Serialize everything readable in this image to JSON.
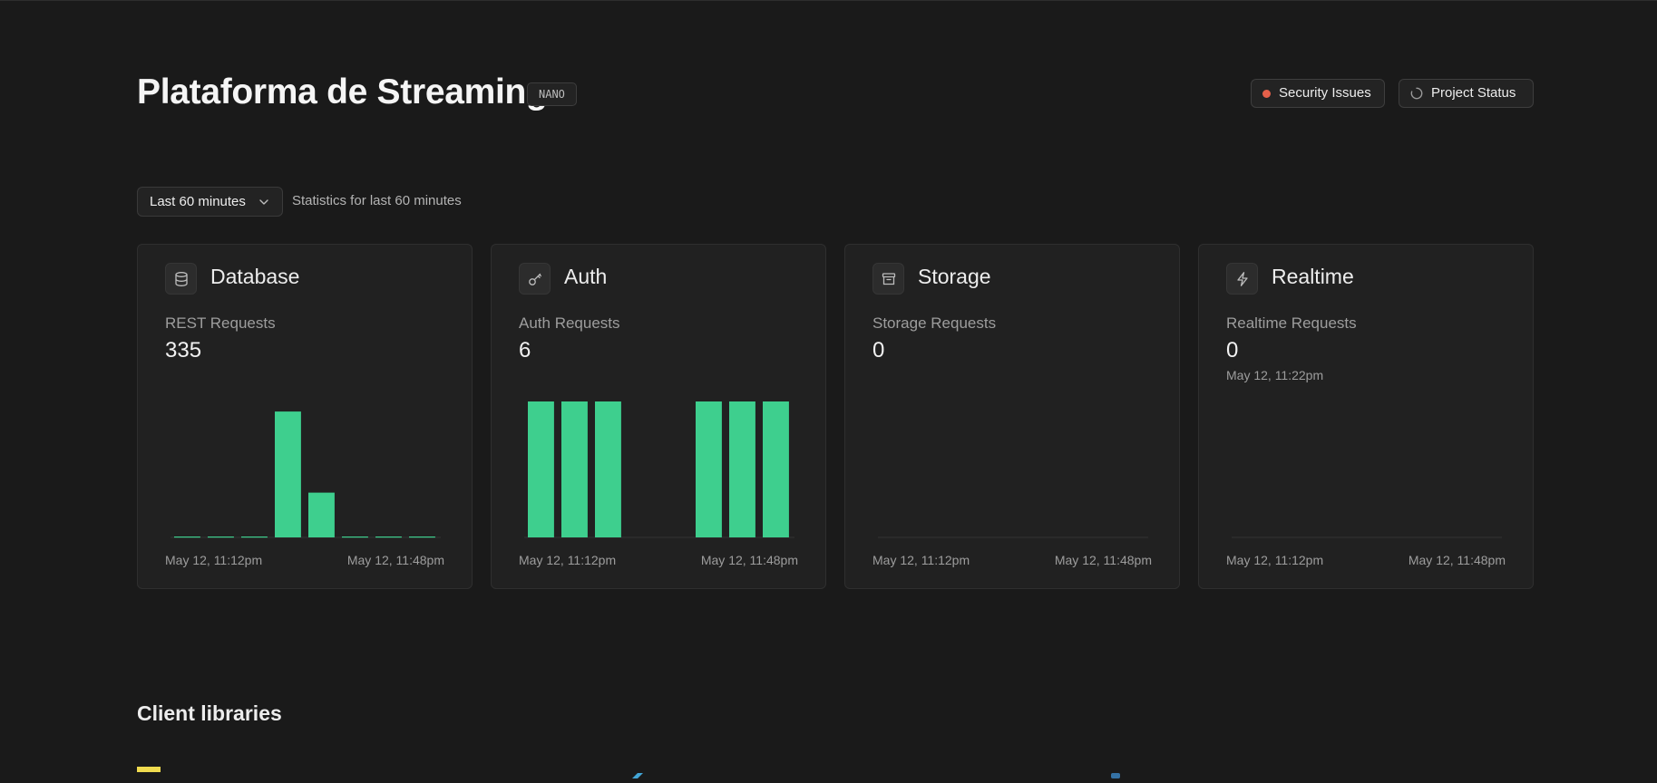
{
  "project": {
    "title": "Plataforma de Streaming",
    "tier": "NANO"
  },
  "header_actions": {
    "security_label": "Security Issues",
    "status_label": "Project Status"
  },
  "filter": {
    "range_label": "Last 60 minutes",
    "caption": "Statistics for last 60 minutes"
  },
  "colors": {
    "accent": "#3ecf8e",
    "danger": "#e5604a",
    "background": "#1a1a1a",
    "card": "#212121"
  },
  "cards": [
    {
      "title": "Database",
      "icon": "database-icon",
      "metric_label": "REST Requests",
      "metric_value": "335",
      "sub_label": "",
      "x_start": "May 12, 11:12pm",
      "x_end": "May 12, 11:48pm",
      "chart_data": {
        "type": "bar",
        "values": [
          0,
          0,
          0,
          225,
          80,
          0,
          0,
          0
        ],
        "ylim": [
          0,
          243
        ]
      }
    },
    {
      "title": "Auth",
      "icon": "key-icon",
      "metric_label": "Auth Requests",
      "metric_value": "6",
      "sub_label": "",
      "x_start": "May 12, 11:12pm",
      "x_end": "May 12, 11:48pm",
      "chart_data": {
        "type": "bar",
        "values": [
          1,
          1,
          1,
          0,
          0,
          1,
          1,
          1
        ],
        "ylim": [
          0,
          1
        ]
      }
    },
    {
      "title": "Storage",
      "icon": "archive-icon",
      "metric_label": "Storage Requests",
      "metric_value": "0",
      "sub_label": "",
      "x_start": "May 12, 11:12pm",
      "x_end": "May 12, 11:48pm",
      "chart_data": {
        "type": "bar",
        "values": [
          0,
          0,
          0,
          0,
          0,
          0,
          0,
          0
        ],
        "ylim": [
          0,
          1
        ]
      }
    },
    {
      "title": "Realtime",
      "icon": "lightning-icon",
      "metric_label": "Realtime Requests",
      "metric_value": "0",
      "sub_label": "May 12, 11:22pm",
      "x_start": "May 12, 11:12pm",
      "x_end": "May 12, 11:48pm",
      "chart_data": {
        "type": "bar",
        "values": [
          0,
          0,
          0,
          0,
          0,
          0,
          0,
          0
        ],
        "ylim": [
          0,
          1
        ]
      }
    }
  ],
  "client_libraries": {
    "title": "Client libraries",
    "items": [
      {
        "icon": "javascript-logo-icon",
        "color": "#f0db4f"
      },
      {
        "icon": "flutter-logo-icon",
        "color": "#42a5d6"
      },
      {
        "icon": "python-logo-icon",
        "color": "#3572a5"
      }
    ]
  }
}
